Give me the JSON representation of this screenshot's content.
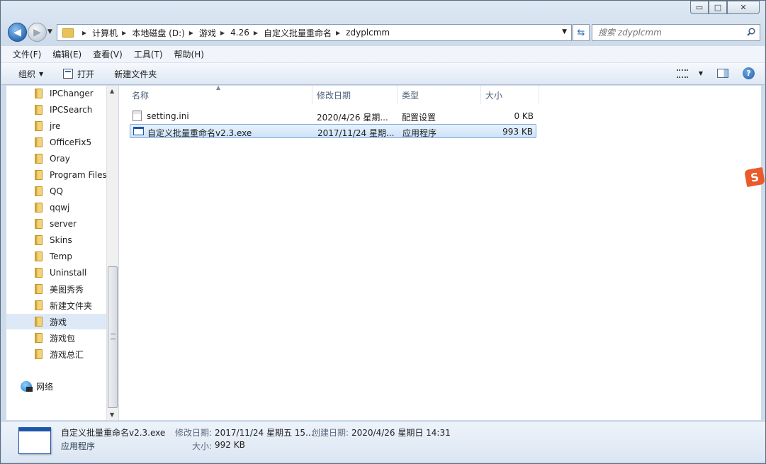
{
  "caption_buttons": {
    "minimize": "▭",
    "maximize": "□",
    "close": "✕"
  },
  "address": {
    "crumbs": [
      "计算机",
      "本地磁盘 (D:)",
      "游戏",
      "4.26",
      "自定义批量重命名",
      "zdyplcmm"
    ],
    "search_placeholder": "搜索 zdyplcmm"
  },
  "menu": [
    "文件(F)",
    "编辑(E)",
    "查看(V)",
    "工具(T)",
    "帮助(H)"
  ],
  "toolbar": {
    "organize": "组织",
    "open": "打开",
    "new_folder": "新建文件夹"
  },
  "sidebar": {
    "folders": [
      "IPChanger",
      "IPCSearch",
      "jre",
      "OfficeFix5",
      "Oray",
      "Program Files",
      "QQ",
      "qqwj",
      "server",
      "Skins",
      "Temp",
      "Uninstall",
      "美图秀秀",
      "新建文件夹",
      "游戏",
      "游戏包",
      "游戏总汇"
    ],
    "selected": "游戏",
    "network": "网络"
  },
  "columns": {
    "name": "名称",
    "date": "修改日期",
    "type": "类型",
    "size": "大小"
  },
  "files": [
    {
      "name": "setting.ini",
      "date": "2020/4/26 星期...",
      "type": "配置设置",
      "size": "0 KB",
      "icon": "ini-file-icon"
    },
    {
      "name": "自定义批量重命名v2.3.exe",
      "date": "2017/11/24 星期...",
      "type": "应用程序",
      "size": "993 KB",
      "icon": "exe-file-icon",
      "selected": true
    }
  ],
  "details": {
    "filename": "自定义批量重命名v2.3.exe",
    "filetype": "应用程序",
    "modified_label": "修改日期:",
    "modified_value": "2017/11/24 星期五 15...",
    "created_label": "创建日期:",
    "created_value": "2020/4/26 星期日 14:31",
    "size_label": "大小:",
    "size_value": "992 KB"
  },
  "tray": {
    "sogou_label": "S"
  }
}
